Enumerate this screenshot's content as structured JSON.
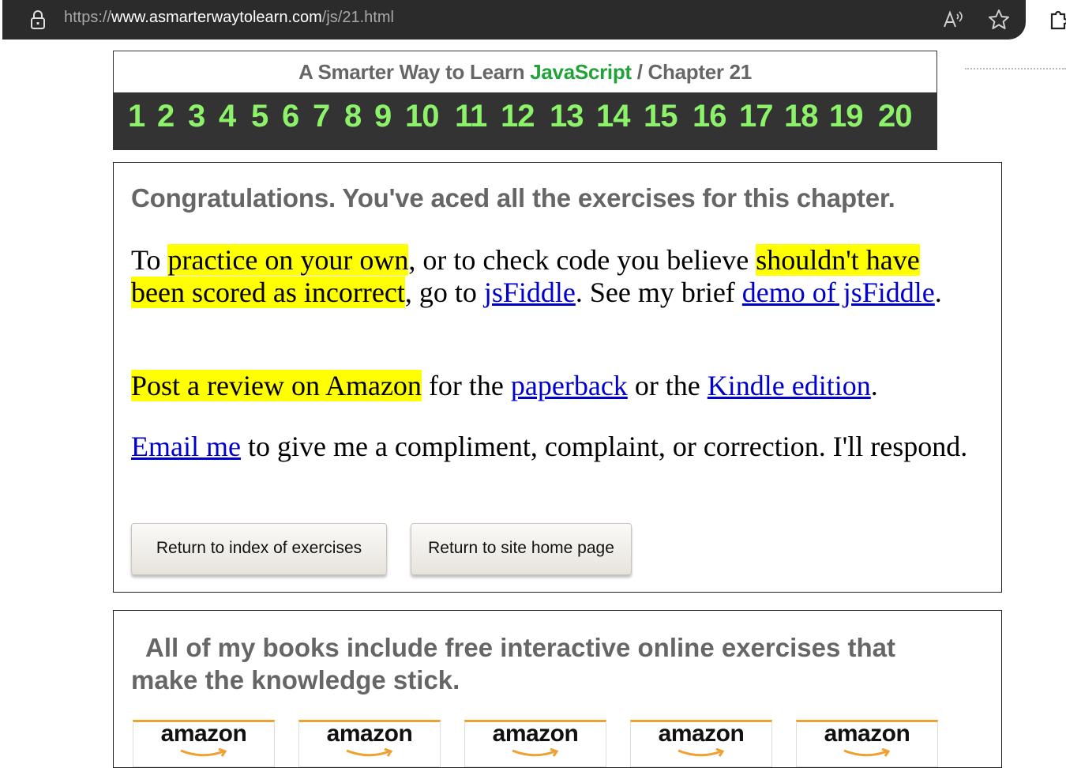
{
  "browser": {
    "url_scheme": "https://",
    "url_host": "www.asmarterwaytolearn.com",
    "url_path": "/js/21.html",
    "read_aloud_label": "A̴"
  },
  "header": {
    "crumb_prefix": "A Smarter Way to Learn ",
    "crumb_js": "JavaScript",
    "crumb_suffix": "  /  Chapter 21",
    "chapters": [
      "1",
      "2",
      "3",
      "4",
      "5",
      "6",
      "7",
      "8",
      "9",
      "10",
      "11",
      "12",
      "13",
      "14",
      "15",
      "16",
      "17",
      "18",
      "19",
      "20"
    ]
  },
  "main": {
    "congrats": "Congratulations. You've aced all the exercises for this chapter.",
    "p1": {
      "t1": "To ",
      "h1": "practice on your own",
      "t2": ", or to check code you believe ",
      "h2": "shouldn't have been scored as incorrect",
      "t3": ", go to ",
      "link1": "jsFiddle",
      "t4": ". See my brief ",
      "link2": "demo of jsFiddle",
      "t5": "."
    },
    "p2": {
      "h1": "Post a review on Amazon",
      "t1": " for the ",
      "link1": "paperback",
      "t2": " or the ",
      "link2": "Kindle edition",
      "t3": "."
    },
    "p3": {
      "link1": "Email me",
      "t1": " to give me a compliment, complaint, or correction. I'll respond."
    },
    "buttons": {
      "index": "Return to index of exercises",
      "home": "Return to site home page"
    }
  },
  "books": {
    "heading": "All of my books include free interactive online exercises that make the knowledge stick.",
    "amazon_label": "amazon"
  },
  "colors": {
    "javascript_green": "#22a33a",
    "chapter_green": "#8cf26a",
    "highlight": "#ffff00",
    "link": "#0000cc"
  }
}
